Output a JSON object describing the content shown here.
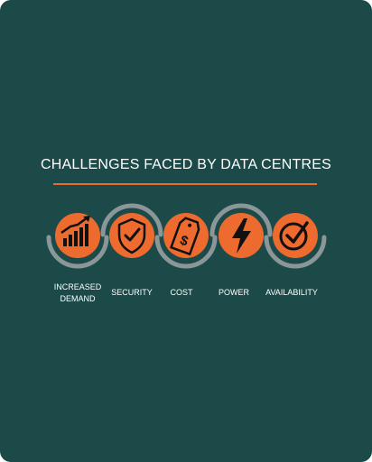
{
  "title": "CHALLENGES FACED BY DATA CENTRES",
  "colors": {
    "background": "#1c4a49",
    "accent": "#ee6b2f",
    "arc": "#8a9697",
    "text": "#ffffff"
  },
  "items": [
    {
      "label": "INCREASED\nDEMAND",
      "icon": "bar-chart-trend-icon"
    },
    {
      "label": "SECURITY",
      "icon": "shield-check-icon"
    },
    {
      "label": "COST",
      "icon": "price-tag-dollar-icon"
    },
    {
      "label": "POWER",
      "icon": "lightning-bolt-icon"
    },
    {
      "label": "AVAILABILITY",
      "icon": "check-circle-icon"
    }
  ]
}
